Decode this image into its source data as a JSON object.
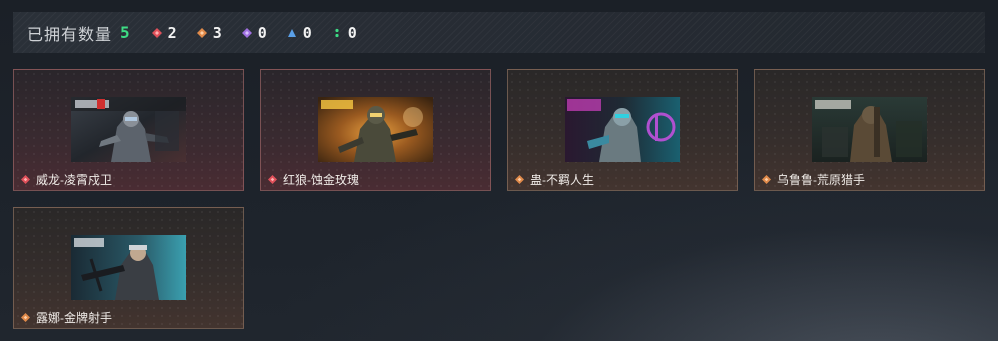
{
  "header": {
    "label": "已拥有数量",
    "total": "5",
    "rarities": [
      {
        "icon": "red-diamond-icon",
        "color": "#e0505a",
        "count": "2"
      },
      {
        "icon": "orange-diamond-icon",
        "color": "#e08a4a",
        "count": "3"
      },
      {
        "icon": "purple-diamond-icon",
        "color": "#a070e0",
        "count": "0"
      },
      {
        "icon": "blue-triangle-icon",
        "color": "#5aa0e8",
        "count": "0"
      },
      {
        "icon": "green-dots-icon",
        "color": "#3ddc84",
        "count": "0"
      }
    ]
  },
  "cards": [
    {
      "name": "威龙-凌霄戍卫",
      "rarity": "red",
      "gem_color": "#e0505a"
    },
    {
      "name": "红狼-蚀金玫瑰",
      "rarity": "red",
      "gem_color": "#e0505a"
    },
    {
      "name": "蛊-不羁人生",
      "rarity": "orange",
      "gem_color": "#e08a4a"
    },
    {
      "name": "乌鲁鲁-荒原猎手",
      "rarity": "orange",
      "gem_color": "#e08a4a"
    },
    {
      "name": "露娜-金牌射手",
      "rarity": "orange",
      "gem_color": "#e08a4a"
    }
  ]
}
